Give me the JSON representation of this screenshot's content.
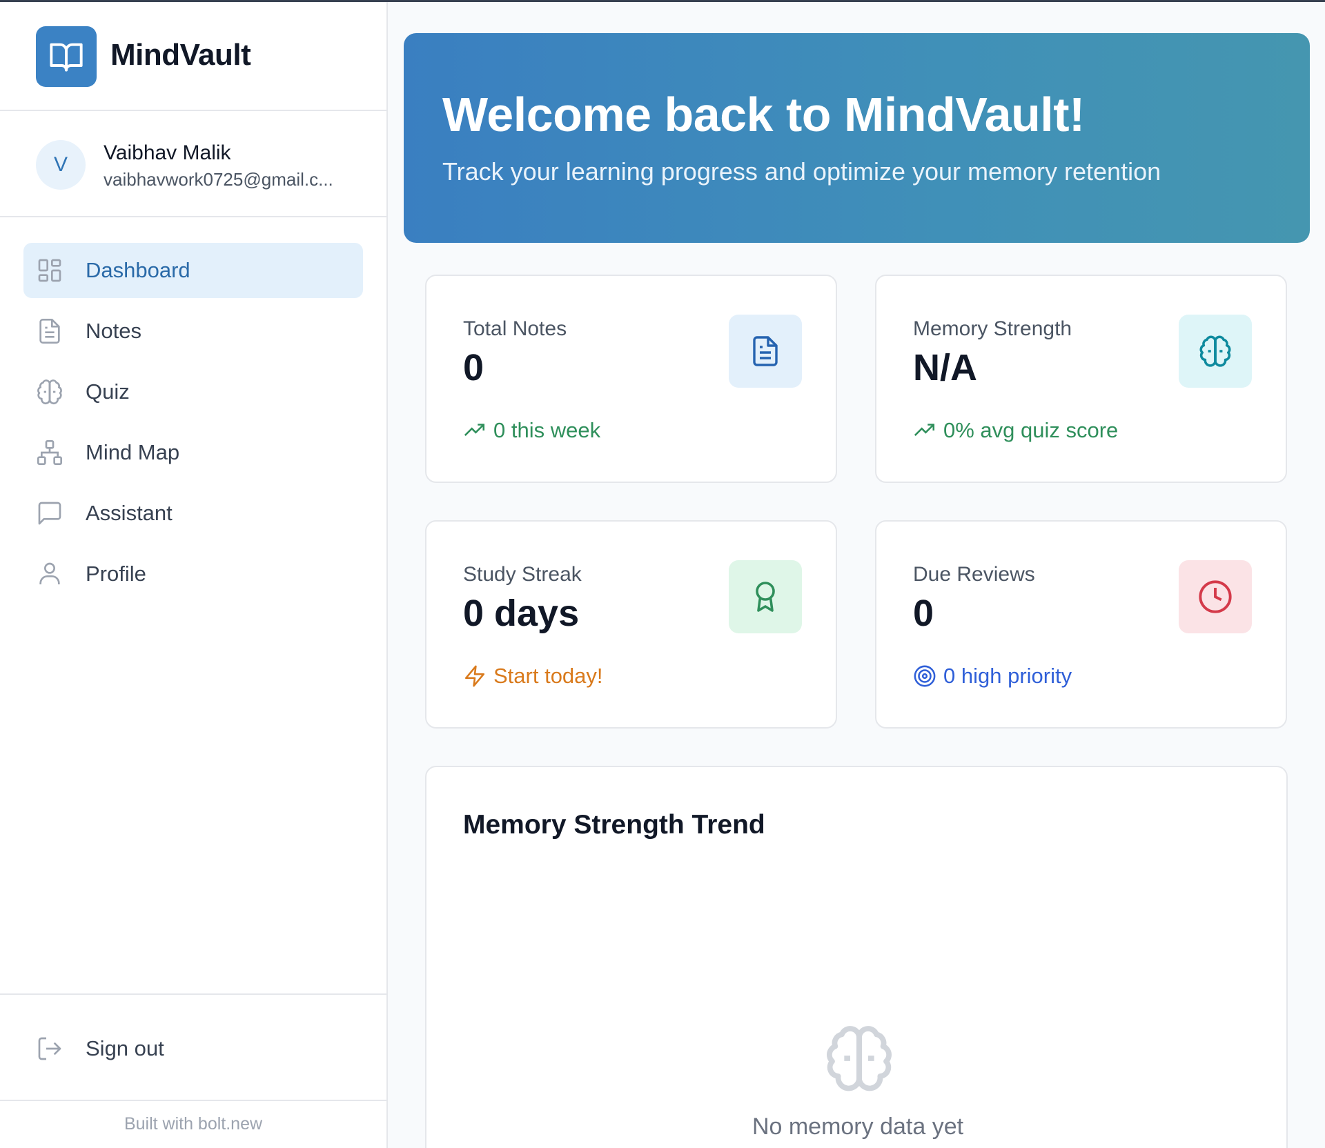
{
  "brand": {
    "name": "MindVault",
    "icon": "book-open-icon",
    "color": "#3b82c4"
  },
  "user": {
    "initial": "V",
    "name": "Vaibhav Malik",
    "email": "vaibhavwork0725@gmail.c..."
  },
  "nav": {
    "items": [
      {
        "label": "Dashboard",
        "icon": "dashboard-grid-icon",
        "active": true
      },
      {
        "label": "Notes",
        "icon": "document-icon",
        "active": false
      },
      {
        "label": "Quiz",
        "icon": "brain-icon",
        "active": false
      },
      {
        "label": "Mind Map",
        "icon": "network-icon",
        "active": false
      },
      {
        "label": "Assistant",
        "icon": "chat-bubble-icon",
        "active": false
      },
      {
        "label": "Profile",
        "icon": "user-icon",
        "active": false
      }
    ],
    "signout_label": "Sign out"
  },
  "footer": {
    "note": "Built with bolt.new"
  },
  "hero": {
    "title": "Welcome back to MindVault!",
    "subtitle": "Track your learning progress and optimize your memory retention"
  },
  "stats": {
    "total_notes": {
      "label": "Total Notes",
      "value": "0",
      "foot": "0 this week",
      "icon": "document-icon",
      "foot_icon": "trending-up-icon",
      "accent": "#2563b0",
      "foot_color": "#2f8f5b"
    },
    "memory_strength": {
      "label": "Memory Strength",
      "value": "N/A",
      "foot": "0% avg quiz score",
      "icon": "brain-icon",
      "foot_icon": "trending-up-icon",
      "accent": "#0e8a9e",
      "foot_color": "#2f8f5b"
    },
    "study_streak": {
      "label": "Study Streak",
      "value": "0 days",
      "foot": "Start today!",
      "icon": "award-icon",
      "foot_icon": "lightning-icon",
      "accent": "#2f8f5b",
      "foot_color": "#d97a1c"
    },
    "due_reviews": {
      "label": "Due Reviews",
      "value": "0",
      "foot": "0 high priority",
      "icon": "clock-icon",
      "foot_icon": "target-icon",
      "accent": "#d43a4a",
      "foot_color": "#2f5fd8"
    }
  },
  "trend": {
    "title": "Memory Strength Trend",
    "empty_text": "No memory data yet",
    "empty_icon": "brain-icon"
  }
}
